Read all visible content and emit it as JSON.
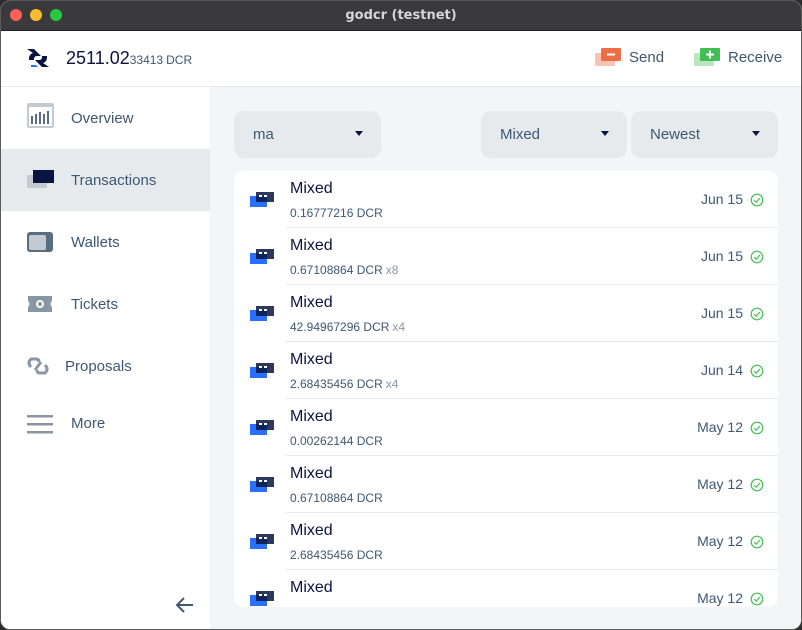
{
  "window": {
    "title": "godcr (testnet)"
  },
  "header": {
    "balance_main": "2511.02",
    "balance_small": "33413",
    "balance_unit": "DCR",
    "send_label": "Send",
    "receive_label": "Receive"
  },
  "sidebar": {
    "items": [
      {
        "label": "Overview",
        "icon": "overview-icon"
      },
      {
        "label": "Transactions",
        "icon": "transactions-icon",
        "active": true
      },
      {
        "label": "Wallets",
        "icon": "wallet-icon"
      },
      {
        "label": "Tickets",
        "icon": "ticket-icon"
      },
      {
        "label": "Proposals",
        "icon": "proposals-icon"
      },
      {
        "label": "More",
        "icon": "menu-icon"
      }
    ]
  },
  "filters": {
    "wallet": "ma",
    "type": "Mixed",
    "sort": "Newest"
  },
  "transactions": [
    {
      "type": "Mixed",
      "amount": "0.16777216 DCR",
      "multiplier": "",
      "date": "Jun 15"
    },
    {
      "type": "Mixed",
      "amount": "0.67108864 DCR",
      "multiplier": "x8",
      "date": "Jun 15"
    },
    {
      "type": "Mixed",
      "amount": "42.94967296 DCR",
      "multiplier": "x4",
      "date": "Jun 15"
    },
    {
      "type": "Mixed",
      "amount": "2.68435456 DCR",
      "multiplier": "x4",
      "date": "Jun 14"
    },
    {
      "type": "Mixed",
      "amount": "0.00262144 DCR",
      "multiplier": "",
      "date": "May 12"
    },
    {
      "type": "Mixed",
      "amount": "0.67108864 DCR",
      "multiplier": "",
      "date": "May 12"
    },
    {
      "type": "Mixed",
      "amount": "2.68435456 DCR",
      "multiplier": "",
      "date": "May 12"
    },
    {
      "type": "Mixed",
      "amount": "",
      "multiplier": "",
      "date": "May 12"
    }
  ],
  "colors": {
    "accent_blue": "#2970ff",
    "dark_blue": "#091440",
    "text": "#3d5873",
    "send_orange": "#ed6d47",
    "receive_green": "#41bf53",
    "confirmed_green": "#41bf53"
  }
}
